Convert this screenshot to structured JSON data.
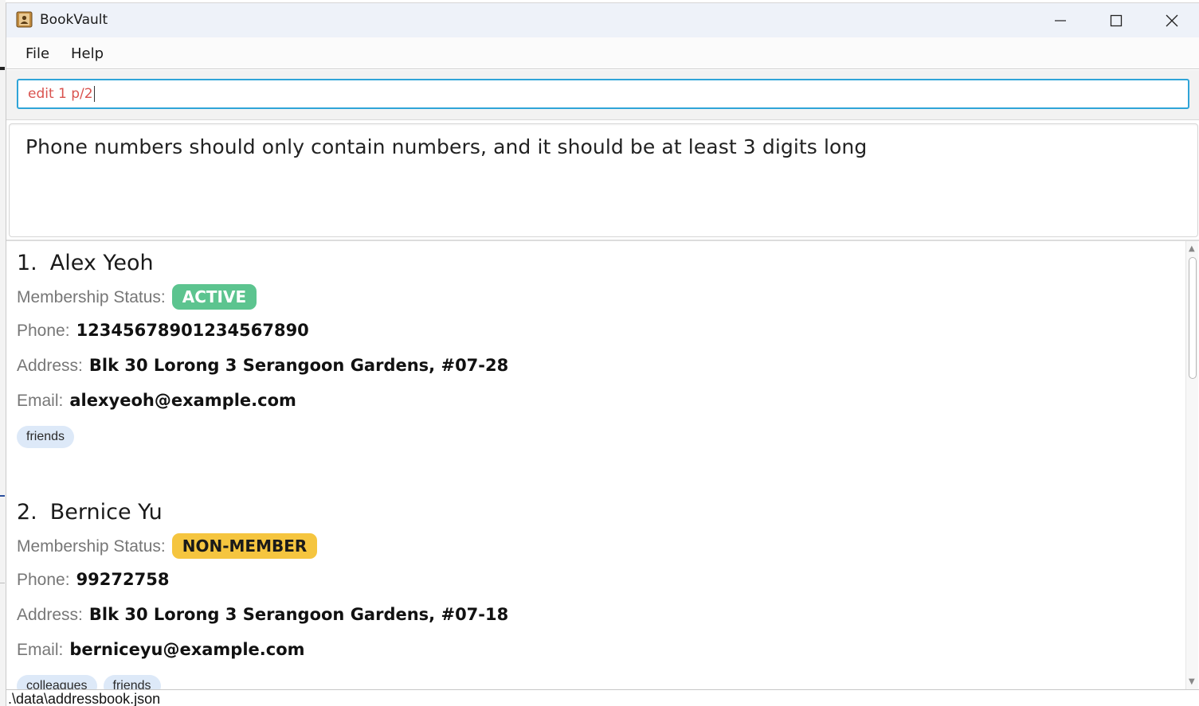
{
  "window": {
    "title": "BookVault",
    "icon": "address-book-icon"
  },
  "menu": {
    "file": "File",
    "help": "Help"
  },
  "command": {
    "value": "edit 1 p/2"
  },
  "result": {
    "message": "Phone numbers should only contain numbers, and it should be at least 3 digits long"
  },
  "labels": {
    "membership": "Membership Status:",
    "phone": "Phone:",
    "address": "Address:",
    "email": "Email:"
  },
  "persons": [
    {
      "index": "1.",
      "name": "Alex Yeoh",
      "status": "ACTIVE",
      "phone": "12345678901234567890",
      "address": "Blk 30 Lorong 3 Serangoon Gardens, #07-28",
      "email": "alexyeoh@example.com",
      "tags": [
        "friends"
      ]
    },
    {
      "index": "2.",
      "name": "Bernice Yu",
      "status": "NON-MEMBER",
      "phone": "99272758",
      "address": "Blk 30 Lorong 3 Serangoon Gardens, #07-18",
      "email": "berniceyu@example.com",
      "tags": [
        "colleagues",
        "friends"
      ]
    }
  ],
  "status_bar": {
    "path": ".\\data\\addressbook.json"
  },
  "colors": {
    "active_badge": "#5cc48f",
    "nonmember_badge": "#f5c53f",
    "input_border": "#2fa4d8",
    "input_text": "#d9534f",
    "tag_bg": "#dde9f8"
  }
}
